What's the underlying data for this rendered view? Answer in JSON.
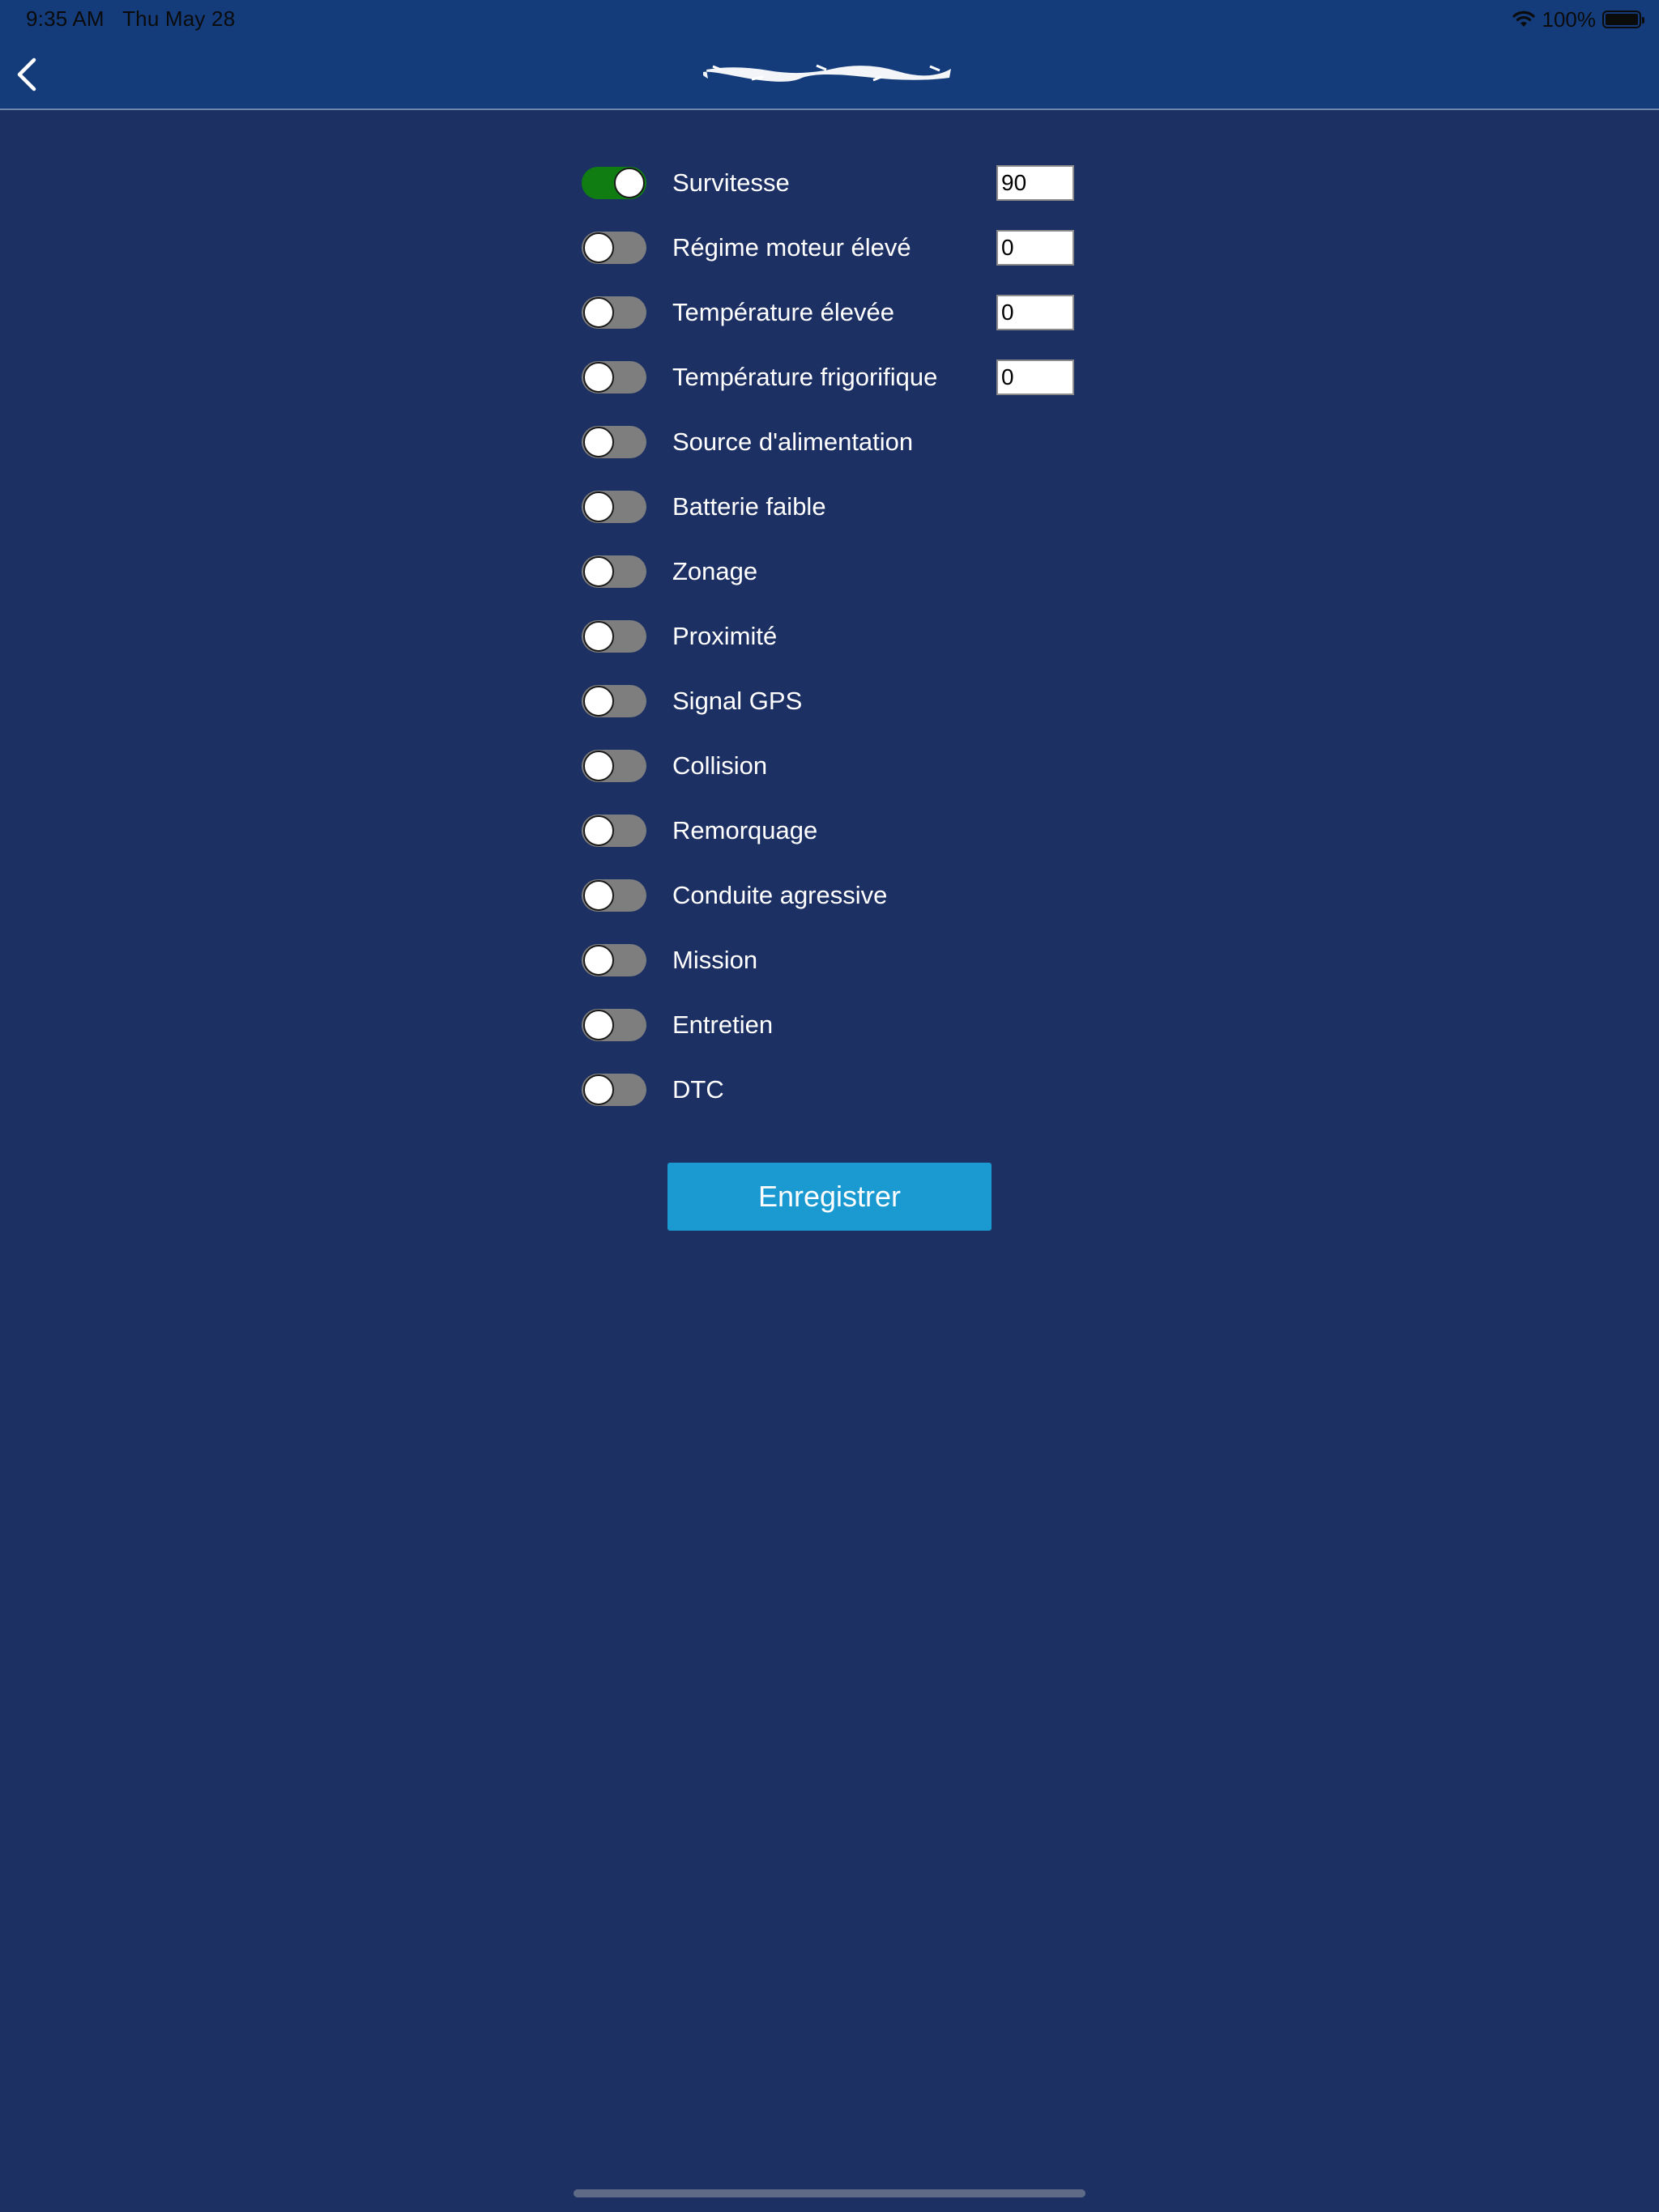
{
  "status_bar": {
    "time": "9:35 AM",
    "date": "Thu May 28",
    "battery_text": "100%",
    "wifi_icon": "wifi-icon",
    "battery_icon": "battery-icon"
  },
  "header": {
    "back_icon": "chevron-left-icon",
    "title_redacted": true
  },
  "settings": [
    {
      "label": "Survitesse",
      "on": true,
      "value": "90"
    },
    {
      "label": "Régime moteur élevé",
      "on": false,
      "value": "0"
    },
    {
      "label": "Température élevée",
      "on": false,
      "value": "0"
    },
    {
      "label": "Température frigorifique",
      "on": false,
      "value": "0"
    },
    {
      "label": "Source d'alimentation",
      "on": false
    },
    {
      "label": "Batterie faible",
      "on": false
    },
    {
      "label": "Zonage",
      "on": false
    },
    {
      "label": "Proximité",
      "on": false
    },
    {
      "label": "Signal GPS",
      "on": false
    },
    {
      "label": "Collision",
      "on": false
    },
    {
      "label": "Remorquage",
      "on": false
    },
    {
      "label": "Conduite agressive",
      "on": false
    },
    {
      "label": "Mission",
      "on": false
    },
    {
      "label": "Entretien",
      "on": false
    },
    {
      "label": "DTC",
      "on": false
    }
  ],
  "save_label": "Enregistrer",
  "colors": {
    "background": "#1d3063",
    "header": "#143c7b",
    "toggle_on": "#0f7d12",
    "toggle_off": "#7e7e7e",
    "button": "#1a9ad1"
  }
}
